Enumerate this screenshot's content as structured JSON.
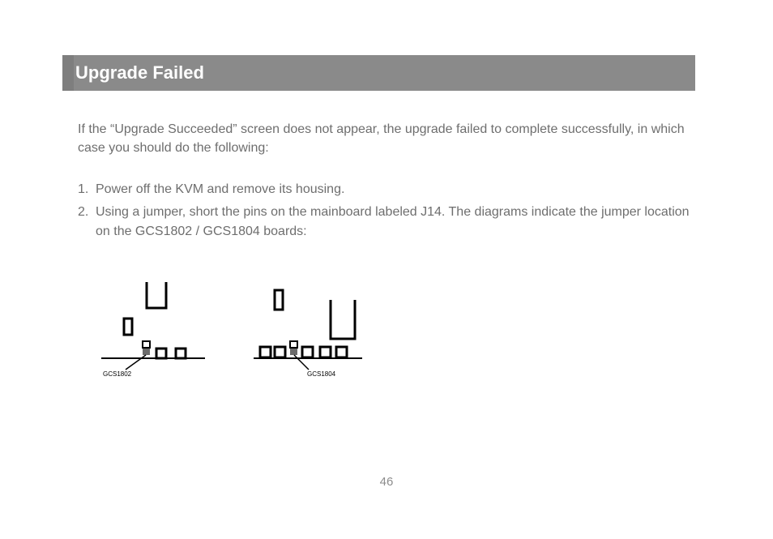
{
  "title": "Upgrade Failed",
  "intro": "If the “Upgrade Succeeded” screen does not appear, the upgrade failed to complete successfully, in which case you should do the following:",
  "steps": [
    {
      "n": "1.",
      "text": "Power off the KVM and remove its housing."
    },
    {
      "n": "2.",
      "text": "Using a jumper, short the pins on the mainboard labeled J14. The diagrams indicate the jumper location on the GCS1802 / GCS1804 boards:"
    }
  ],
  "diagram_labels": {
    "left": "GCS1802",
    "right": "GCS1804"
  },
  "page_number": "46"
}
